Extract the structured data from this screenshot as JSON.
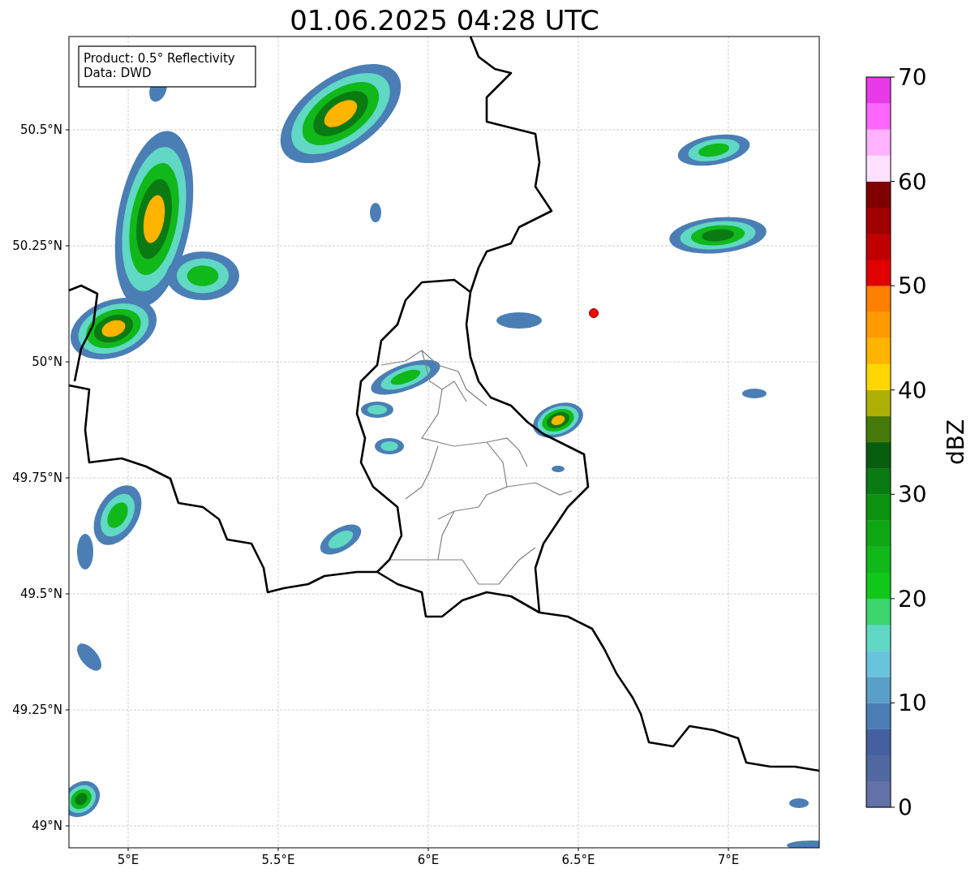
{
  "title": "01.06.2025 04:28 UTC",
  "info_box": {
    "lines": [
      "Product: 0.5° Reflectivity",
      "Data: DWD"
    ]
  },
  "map": {
    "xticks": [
      "5°E",
      "5.5°E",
      "6°E",
      "6.5°E",
      "7°E"
    ],
    "yticks": [
      "50.5°N",
      "50.25°N",
      "50°N",
      "49.75°N",
      "49.5°N",
      "49.25°N",
      "49°N"
    ]
  },
  "colorbar": {
    "label": "dBZ",
    "ticks": [
      "70",
      "60",
      "50",
      "40",
      "30",
      "20",
      "10",
      "0"
    ],
    "bins": [
      {
        "color": "#6470a8"
      },
      {
        "color": "#5068a0"
      },
      {
        "color": "#4460a0"
      },
      {
        "color": "#4a7eb5"
      },
      {
        "color": "#5a9fc8"
      },
      {
        "color": "#68c4dc"
      },
      {
        "color": "#60d8c4"
      },
      {
        "color": "#3cd46c"
      },
      {
        "color": "#10c81a"
      },
      {
        "color": "#10b81a"
      },
      {
        "color": "#0ea814"
      },
      {
        "color": "#0c9410"
      },
      {
        "color": "#0a7a12"
      },
      {
        "color": "#085e0e"
      },
      {
        "color": "#467a0a"
      },
      {
        "color": "#aeb008"
      },
      {
        "color": "#ffd700"
      },
      {
        "color": "#ffb400"
      },
      {
        "color": "#ff9a00"
      },
      {
        "color": "#ff7f00"
      },
      {
        "color": "#e00000"
      },
      {
        "color": "#c00000"
      },
      {
        "color": "#a00000"
      },
      {
        "color": "#7e0000"
      },
      {
        "color": "#ffe0ff"
      },
      {
        "color": "#ffb3ff"
      },
      {
        "color": "#ff66ff"
      },
      {
        "color": "#e83ae8"
      }
    ]
  }
}
